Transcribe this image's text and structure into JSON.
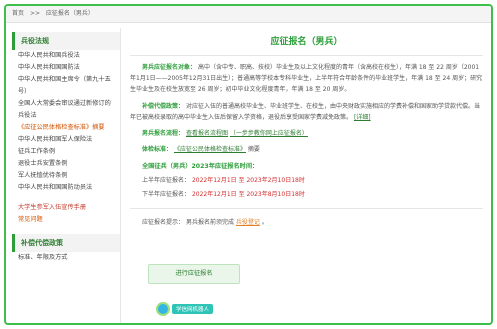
{
  "breadcrumb": {
    "home": "首页",
    "sep": ">>",
    "current": "应征报名（男兵）"
  },
  "sidebar": {
    "section1": "兵役法规",
    "items1": [
      {
        "label": "中华人民共和国兵役法",
        "style": ""
      },
      {
        "label": "中华人民共和国国防法",
        "style": ""
      },
      {
        "label": "中华人民共和国主席令（第九十五号）",
        "style": ""
      },
      {
        "label": "全国人大常委会审议通过新修订的兵役法",
        "style": ""
      },
      {
        "label": "《应征公民体格检查标准》摘要",
        "style": "orange"
      },
      {
        "label": "中华人民共和国军人保险法",
        "style": ""
      },
      {
        "label": "征兵工作条例",
        "style": ""
      },
      {
        "label": "退役士兵安置条例",
        "style": ""
      },
      {
        "label": "军人抚恤优待条例",
        "style": ""
      },
      {
        "label": "中华人民共和国国防动员法",
        "style": ""
      }
    ],
    "handbook": "大学生参军入伍宣传手册",
    "faq": "常见问题",
    "section2": "补偿代偿政策",
    "items2": [
      {
        "label": "标准、年限及方式"
      }
    ]
  },
  "main": {
    "title": "应征报名（男兵）",
    "target_label": "男兵应征报名对象：",
    "target_text": "高中（含中专、职高、技校）毕业生及以上文化程度的青年（含高校在校生），年满 18 至 22 周岁（2001年1月1日——2005年12月31日出生）；普通高等学校本专科毕业生，上半年符合年龄条件的毕业班学生，年满 18 至 24 周岁；研究生毕业生及在校生放宽至 26 周岁；初中毕业文化程度青年，年满 18 至 20 周岁。",
    "comp_label": "补偿代偿政策：",
    "comp_text": "对应征入伍的普通高校毕业生、毕业班学生、在校生，由中央财政实施相应的学费补偿和国家助学贷款代偿。当年已被高校录取的高中毕业生入伍后保留入学资格，退役后享受国家学费减免政策。",
    "comp_link": "[详细]",
    "flow_label": "男兵报名流程：",
    "flow_text": "查看报名流程图",
    "flow_link": "（一步步教你网上应征报名）",
    "exam_label": "体检标准：",
    "exam_link": "《应征公民体格检查标准》",
    "exam_suffix": "摘要",
    "period_title": "全国征兵（男兵）2023年应征报名时间：",
    "first_half_label": "上半年应征报名：",
    "first_half_time": "2022年12月1日 至 2023年2月10日18时",
    "second_half_label": "下半年应征报名：",
    "second_half_time": "2022年12月1日 至 2023年8月10日18时",
    "hint_label": "应征报名提示：",
    "hint_text": "男兵报名前须完成",
    "hint_link": "兵役登记",
    "hint_end": "。",
    "button": "进行应征报名",
    "badge": "学信网机器人"
  }
}
